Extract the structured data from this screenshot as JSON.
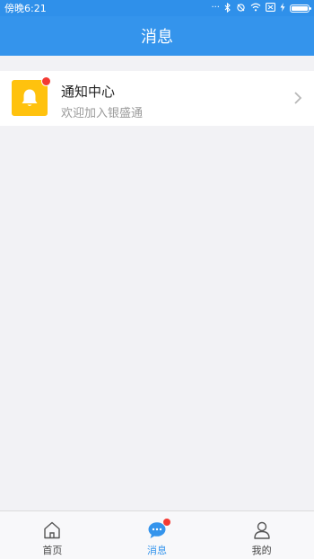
{
  "statusbar": {
    "time": "傍晚6:21",
    "icons": [
      "dots-icon",
      "bluetooth-icon",
      "rotate-icon",
      "wifi-icon",
      "sim-icon",
      "charging-icon",
      "battery-icon"
    ],
    "battery_level": 1.0
  },
  "header": {
    "title": "消息"
  },
  "messages": [
    {
      "title": "通知中心",
      "subtitle": "欢迎加入银盛通",
      "icon": "bell-icon",
      "unread": true
    }
  ],
  "tabs": [
    {
      "label": "首页",
      "icon": "home-icon",
      "active": false
    },
    {
      "label": "消息",
      "icon": "chat-icon",
      "active": true,
      "badge": true
    },
    {
      "label": "我的",
      "icon": "user-icon",
      "active": false
    }
  ],
  "colors": {
    "primary": "#3494ec",
    "badge": "#f33a33",
    "bell_bg": "#ffc20e",
    "background": "#f2f2f5"
  }
}
